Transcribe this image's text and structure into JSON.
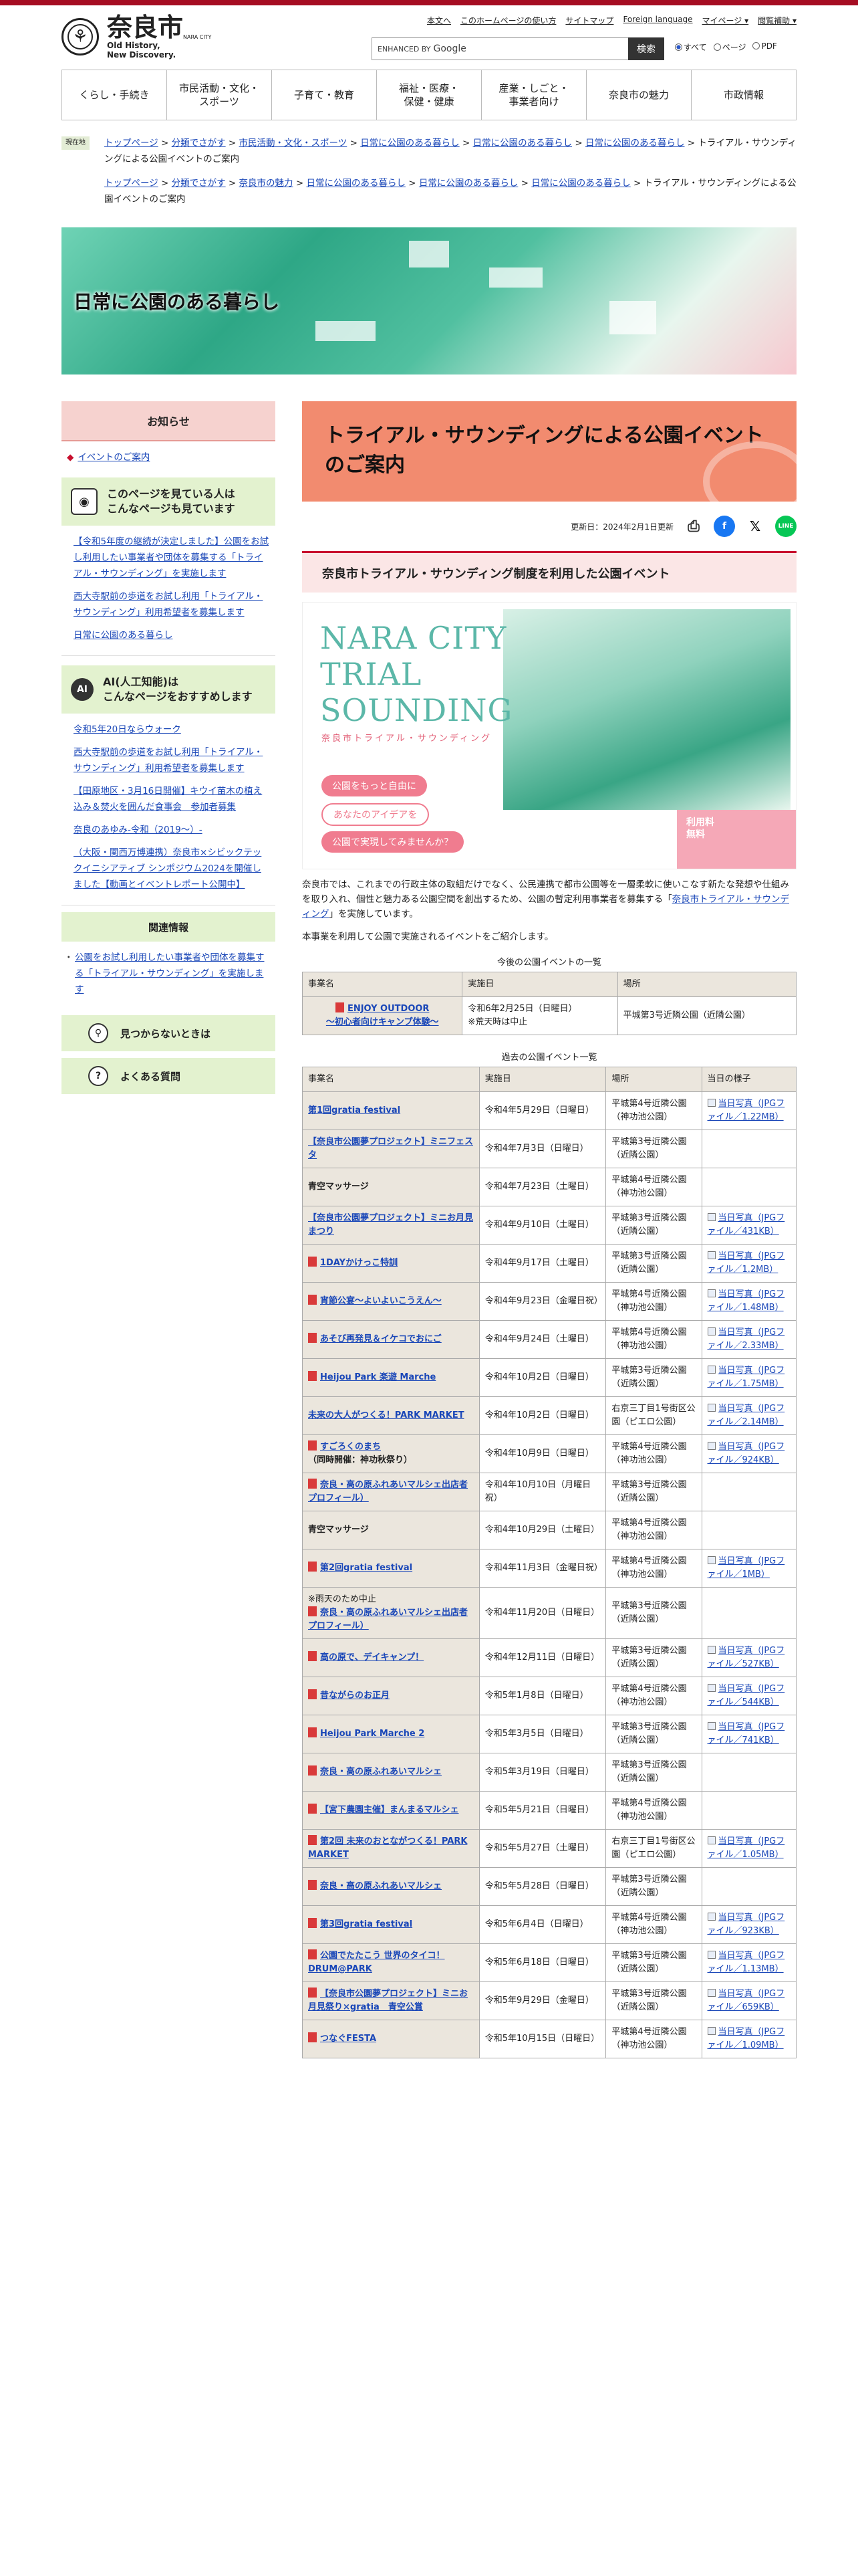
{
  "header": {
    "logo_jp": "奈良市",
    "logo_en1": "Old History,",
    "logo_en2": "New Discovery.",
    "logo_sub": "NARA CITY",
    "utils": [
      "本文へ",
      "このホームページの使い方",
      "サイトマップ",
      "Foreign language",
      "マイページ ▾",
      "閲覧補助 ▾"
    ],
    "search_brand": "ENHANCED BY",
    "search_google": "Google",
    "search_btn": "検索",
    "scope": [
      "すべて",
      "ページ",
      "PDF"
    ]
  },
  "gnav": [
    "くらし・手続き",
    "市民活動・文化・\nスポーツ",
    "子育て・教育",
    "福祉・医療・\n保健・健康",
    "産業・しごと・\n事業者向け",
    "奈良市の魅力",
    "市政情報"
  ],
  "breadcrumb": {
    "tag": "現在地",
    "path1": [
      "トップページ",
      "分類でさがす",
      "市民活動・文化・スポーツ",
      "日常に公園のある暮らし",
      "日常に公園のある暮らし",
      "日常に公園のある暮らし"
    ],
    "path2": [
      "トップページ",
      "分類でさがす",
      "奈良市の魅力",
      "日常に公園のある暮らし",
      "日常に公園のある暮らし",
      "日常に公園のある暮らし"
    ],
    "current": "トライアル・サウンディングによる公園イベントのご案内"
  },
  "hero": {
    "title": "日常に公園のある暮らし"
  },
  "sidebar": {
    "notice_head": "お知らせ",
    "notice_link": "イベントのご案内",
    "viewed_head": "このページを見ている人は\nこんなページも見ています",
    "viewed": [
      "【令和5年度の継続が決定しました】公園をお試し利用したい事業者や団体を募集する「トライアル・サウンディング」を実施します",
      "西大寺駅前の歩道をお試し利用「トライアル・サウンディング」利用希望者を募集します",
      "日常に公園のある暮らし"
    ],
    "ai_badge": "AI",
    "ai_head": "AI(人工知能)は\nこんなページをおすすめします",
    "ai": [
      "令和5年20日ならウォーク",
      "西大寺駅前の歩道をお試し利用「トライアル・サウンディング」利用希望者を募集します",
      "【田原地区・3月16日開催】キウイ苗木の植え込み＆焚火を囲んだ食事会　参加者募集",
      "奈良のあゆみ-令和（2019〜）-",
      "（大阪・関西万博連携）奈良市×シビックテックイニシアティブ シンポジウム2024を開催しました【動画とイベントレポート公開中】"
    ],
    "related_head": "関連情報",
    "related": [
      "公園をお試し利用したい事業者や団体を募集する「トライアル・サウンディング」を実施します"
    ],
    "notfound": "見つからないときは",
    "faq": "よくある質問"
  },
  "main": {
    "title": "トライアル・サウンディングによる公園イベントのご案内",
    "updated": "更新日：2024年2月1日更新",
    "h2": "奈良市トライアル・サウンディング制度を利用した公園イベント",
    "banner_big": "NARA CITY\nTRIAL\nSOUNDING",
    "banner_jp": "奈良市トライアル・サウンディング",
    "banner_p1": "公園をもっと自由に",
    "banner_p2": "あなたのアイデアを",
    "banner_p3": "公園で実現してみませんか？",
    "banner_fee": "利用料\n無料",
    "para1a": "奈良市では、これまでの行政主体の取組だけでなく、公民連携で都市公園等を一層柔軟に使いこなす新たな発想や仕組みを取り入れ、個性と魅力ある公園空間を創出するため、公園の暫定利用事業者を募集する「",
    "para1link": "奈良市トライアル・サウンディング",
    "para1b": "」を実施しています。",
    "para2": "本事業を利用して公園で実施されるイベントをご紹介します。",
    "upcoming_caption": "今後の公園イベントの一覧",
    "upcoming_cols": [
      "事業名",
      "実施日",
      "場所"
    ],
    "upcoming": [
      {
        "name": "ENJOY OUTDOOR\n〜初心者向けキャンプ体験〜",
        "date": "令和6年2月25日（日曜日）\n※荒天時は中止",
        "place": "平城第3号近隣公園（近隣公園）"
      }
    ],
    "past_caption": "過去の公園イベント一覧",
    "past_cols": [
      "事業名",
      "実施日",
      "場所",
      "当日の様子"
    ],
    "past": [
      {
        "name": "第1回gratia festival",
        "pdf": false,
        "date": "令和4年5月29日（日曜日）",
        "place": "平城第4号近隣公園（神功池公園）",
        "photo": "当日写真（JPGファイル／1.22MB）"
      },
      {
        "name": "【奈良市公園夢プロジェクト】ミニフェスタ",
        "pdf": false,
        "date": "令和4年7月3日（日曜日）",
        "place": "平城第3号近隣公園（近隣公園）",
        "photo": ""
      },
      {
        "name": "青空マッサージ",
        "plain": true,
        "date": "令和4年7月23日（土曜日）",
        "place": "平城第4号近隣公園（神功池公園）",
        "photo": ""
      },
      {
        "name": "【奈良市公園夢プロジェクト】ミニお月見まつり",
        "pdf": false,
        "date": "令和4年9月10日（土曜日）",
        "place": "平城第3号近隣公園（近隣公園）",
        "photo": "当日写真（JPGファイル／431KB）"
      },
      {
        "name": "1DAYかけっこ特訓",
        "pdf": true,
        "date": "令和4年9月17日（土曜日）",
        "place": "平城第3号近隣公園（近隣公園）",
        "photo": "当日写真（JPGファイル／1.2MB）"
      },
      {
        "name": "宵節公宴〜よいよいこうえん〜",
        "pdf": true,
        "date": "令和4年9月23日（金曜日祝）",
        "place": "平城第4号近隣公園（神功池公園）",
        "photo": "当日写真（JPGファイル／1.48MB）"
      },
      {
        "name": "あそび再発見＆イケコでおにご",
        "pdf": true,
        "date": "令和4年9月24日（土曜日）",
        "place": "平城第4号近隣公園（神功池公園）",
        "photo": "当日写真（JPGファイル／2.33MB）"
      },
      {
        "name": "Heijou Park 楽遊 Marche",
        "pdf": true,
        "date": "令和4年10月2日（日曜日）",
        "place": "平城第3号近隣公園（近隣公園）",
        "photo": "当日写真（JPGファイル／1.75MB）"
      },
      {
        "name": "未来の大人がつくる！PARK MARKET",
        "pdf": false,
        "date": "令和4年10月2日（日曜日）",
        "place": "右京三丁目1号街区公園（ピエロ公園）",
        "photo": "当日写真（JPGファイル／2.14MB）"
      },
      {
        "name": "すごろくのまち",
        "pdf": true,
        "extra": "（同時開催：神功秋祭り）",
        "date": "令和4年10月9日（日曜日）",
        "place": "平城第4号近隣公園（神功池公園）",
        "photo": "当日写真（JPGファイル／924KB）"
      },
      {
        "name": "奈良・高の原ふれあいマルシェ出店者プロフィール）",
        "pdf": true,
        "date": "令和4年10月10日（月曜日祝）",
        "place": "平城第3号近隣公園（近隣公園）",
        "photo": ""
      },
      {
        "name": "青空マッサージ",
        "plain": true,
        "date": "令和4年10月29日（土曜日）",
        "place": "平城第4号近隣公園（神功池公園）",
        "photo": ""
      },
      {
        "name": "第2回gratia festival",
        "pdf": true,
        "date": "令和4年11月3日（金曜日祝）",
        "place": "平城第4号近隣公園（神功池公園）",
        "photo": "当日写真（JPGファイル／1MB）"
      },
      {
        "name": "奈良・高の原ふれあいマルシェ出店者プロフィール）",
        "pdf": true,
        "pre": "※雨天のため中止",
        "date": "令和4年11月20日（日曜日）",
        "place": "平城第3号近隣公園（近隣公園）",
        "photo": ""
      },
      {
        "name": "高の原で、デイキャンプ！",
        "pdf": true,
        "date": "令和4年12月11日（日曜日）",
        "place": "平城第3号近隣公園（近隣公園）",
        "photo": "当日写真（JPGファイル／527KB）"
      },
      {
        "name": "昔ながらのお正月",
        "pdf": true,
        "date": "令和5年1月8日（日曜日）",
        "place": "平城第4号近隣公園（神功池公園）",
        "photo": "当日写真（JPGファイル／544KB）"
      },
      {
        "name": "Heijou Park Marche 2",
        "pdf": true,
        "date": "令和5年3月5日（日曜日）",
        "place": "平城第3号近隣公園（近隣公園）",
        "photo": "当日写真（JPGファイル／741KB）"
      },
      {
        "name": "奈良・高の原ふれあいマルシェ",
        "pdf": true,
        "date": "令和5年3月19日（日曜日）",
        "place": "平城第3号近隣公園（近隣公園）",
        "photo": ""
      },
      {
        "name": "【宮下農園主催】まんまるマルシェ",
        "pdf": true,
        "date": "令和5年5月21日（日曜日）",
        "place": "平城第4号近隣公園（神功池公園）",
        "photo": ""
      },
      {
        "name": "第2回 未来のおとながつくる！PARK MARKET",
        "pdf": true,
        "date": "令和5年5月27日（土曜日）",
        "place": "右京三丁目1号街区公園（ピエロ公園）",
        "photo": "当日写真（JPGファイル／1.05MB）"
      },
      {
        "name": "奈良・高の原ふれあいマルシェ",
        "pdf": true,
        "date": "令和5年5月28日（日曜日）",
        "place": "平城第3号近隣公園（近隣公園）",
        "photo": ""
      },
      {
        "name": "第3回gratia festival",
        "pdf": true,
        "date": "令和5年6月4日（日曜日）",
        "place": "平城第4号近隣公園（神功池公園）",
        "photo": "当日写真（JPGファイル／923KB）"
      },
      {
        "name": "公園でたたこう 世界のタイコ！DRUM@PARK",
        "pdf": true,
        "date": "令和5年6月18日（日曜日）",
        "place": "平城第3号近隣公園（近隣公園）",
        "photo": "当日写真（JPGファイル／1.13MB）"
      },
      {
        "name": "【奈良市公園夢プロジェクト】ミニお月見祭り×gratia　青空公賞",
        "pdf": true,
        "date": "令和5年9月29日（金曜日）",
        "place": "平城第3号近隣公園（近隣公園）",
        "photo": "当日写真（JPGファイル／659KB）"
      },
      {
        "name": "つなぐFESTA",
        "pdf": true,
        "date": "令和5年10月15日（日曜日）",
        "place": "平城第4号近隣公園（神功池公園）",
        "photo": "当日写真（JPGファイル／1.09MB）"
      }
    ]
  },
  "colors": {
    "brand": "#a50d22",
    "accent": "#c8102e",
    "title_bg": "#f28b6f",
    "side_green": "#e3f2cf",
    "side_pink": "#f6d2cf"
  }
}
